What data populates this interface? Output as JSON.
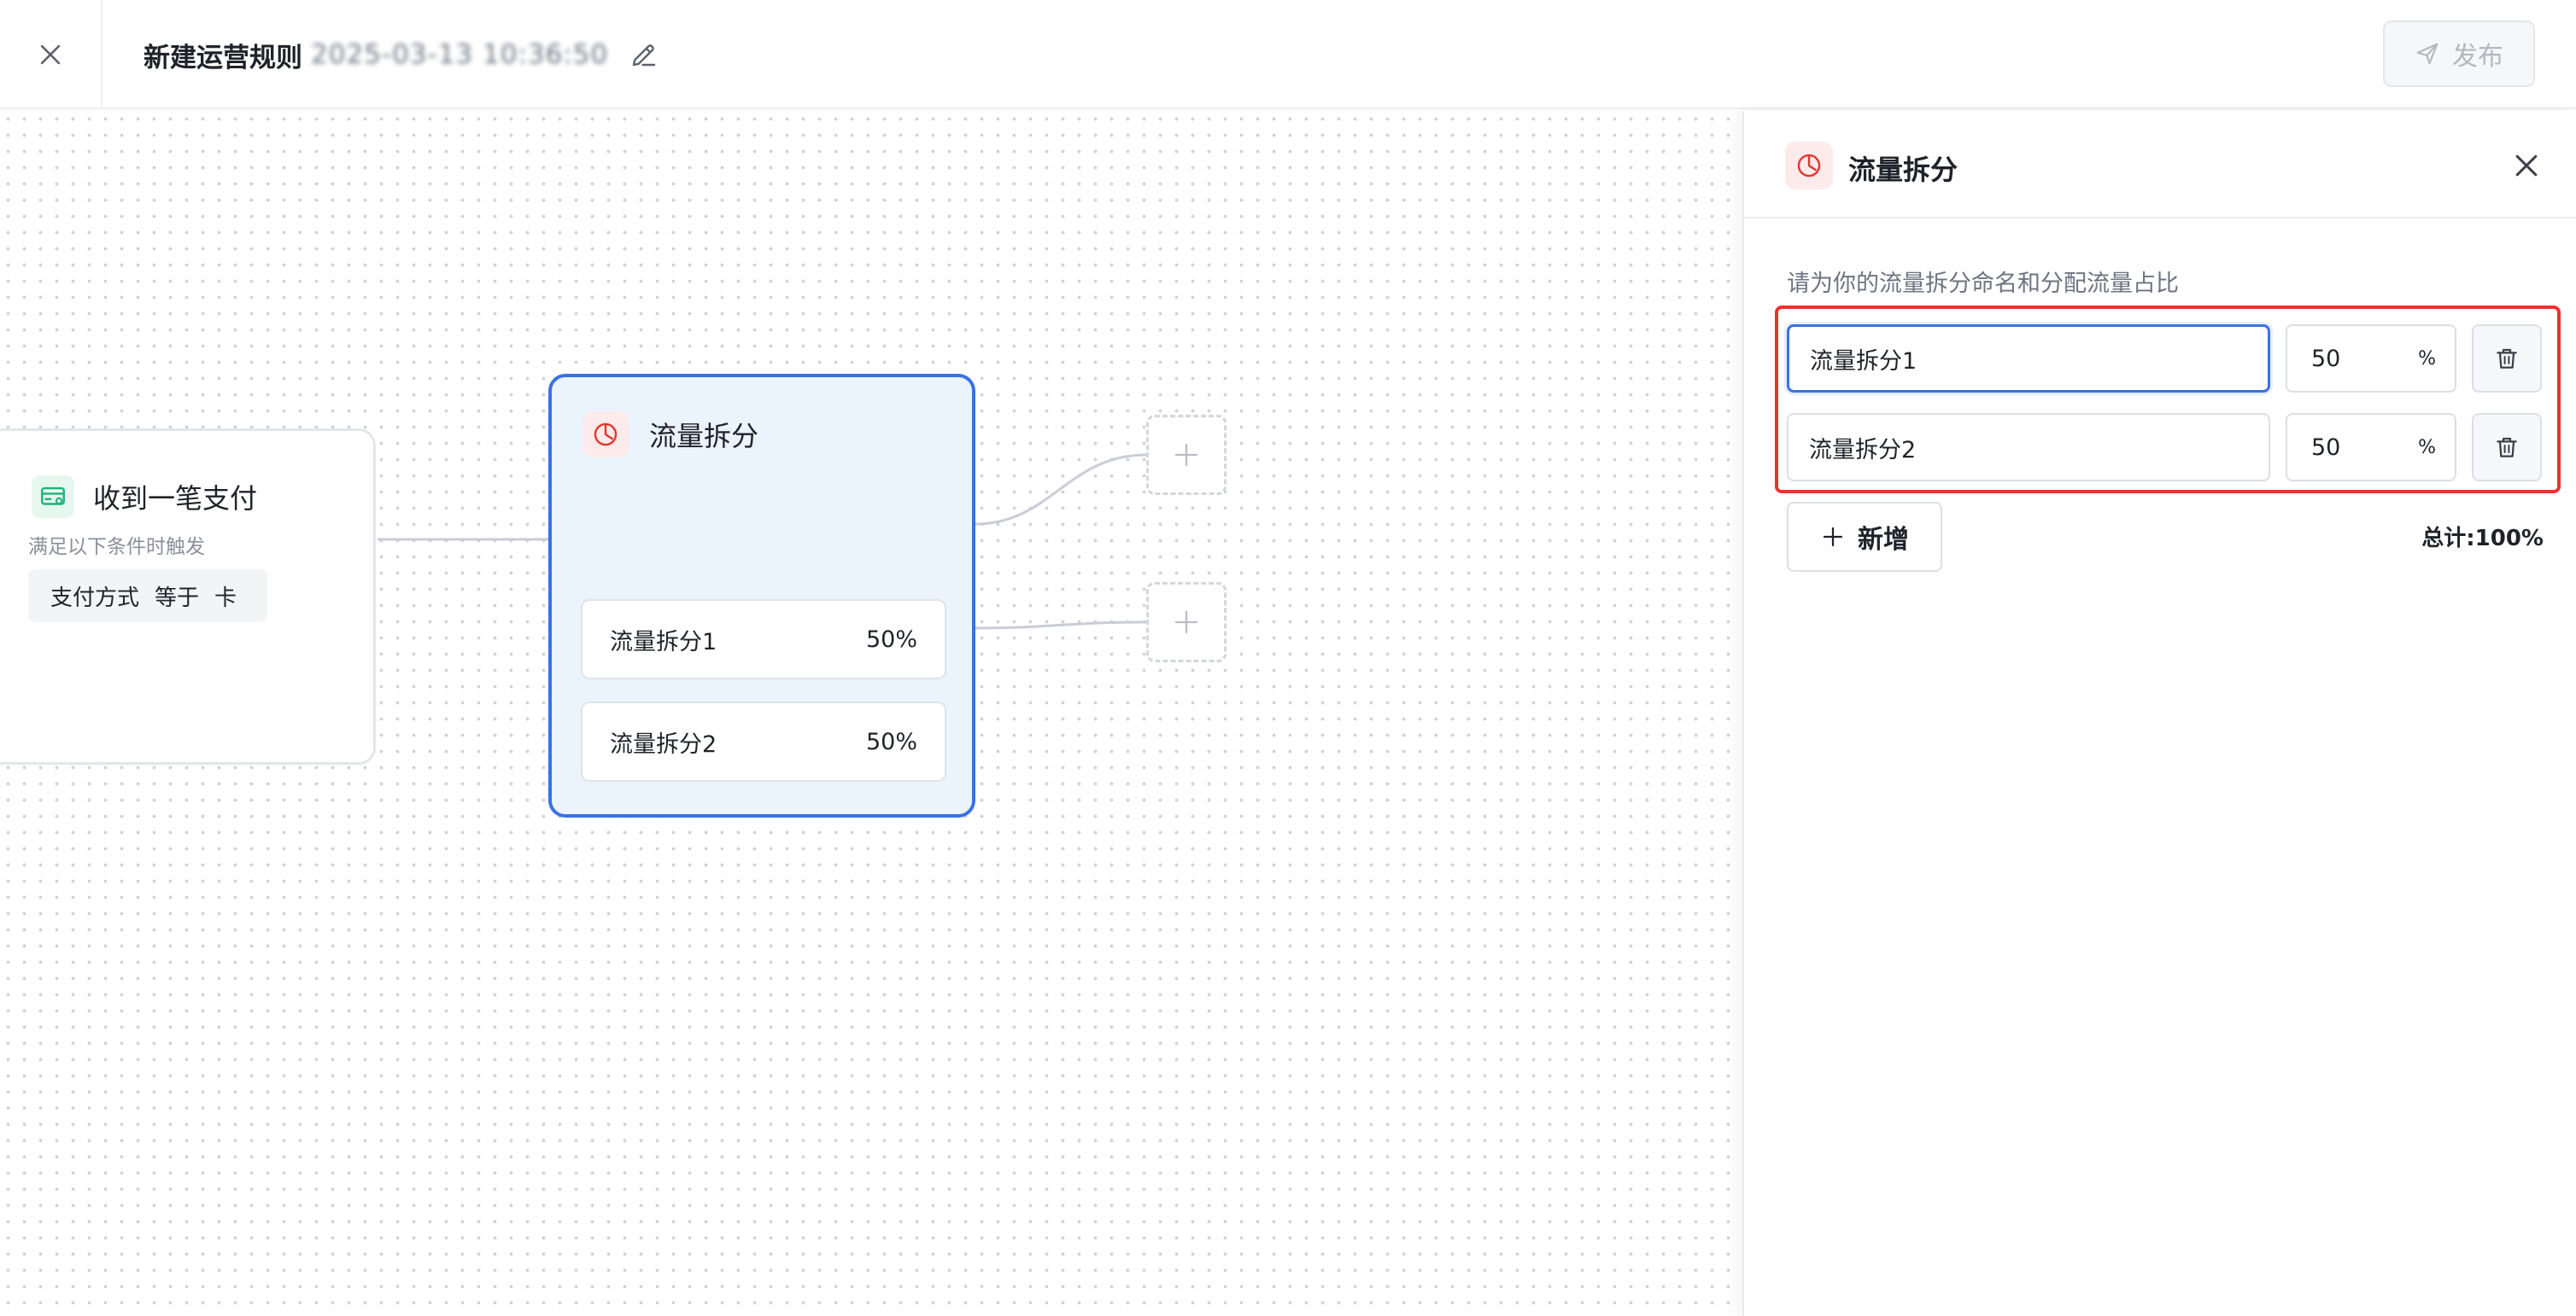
{
  "header": {
    "title": "新建运营规则",
    "title_suffix_blurred": "2025-03-13 10:36:50",
    "publish_label": "发布"
  },
  "trigger_node": {
    "title": "收到一笔支付",
    "subtitle": "满足以下条件时触发",
    "condition": {
      "field": "支付方式",
      "operator": "等于",
      "value": "卡"
    }
  },
  "split_node": {
    "title": "流量拆分",
    "branches": [
      {
        "name": "流量拆分1",
        "percent": "50%"
      },
      {
        "name": "流量拆分2",
        "percent": "50%"
      }
    ]
  },
  "panel": {
    "title": "流量拆分",
    "description": "请为你的流量拆分命名和分配流量占比",
    "rows": [
      {
        "name": "流量拆分1",
        "percent": "50",
        "unit": "%"
      },
      {
        "name": "流量拆分2",
        "percent": "50",
        "unit": "%"
      }
    ],
    "add_label": "新增",
    "total": "总计:100%"
  },
  "colors": {
    "accent_blue": "#3a72e4",
    "split_red": "#e0372f",
    "highlight_red": "#e0372f",
    "trigger_green": "#1bb37a"
  },
  "icons": {
    "close": "close-icon",
    "edit": "pencil-icon",
    "publish": "send-icon",
    "trigger": "card-payment-icon",
    "split": "pie-chart-icon",
    "add": "plus-icon",
    "delete": "trash-icon"
  }
}
